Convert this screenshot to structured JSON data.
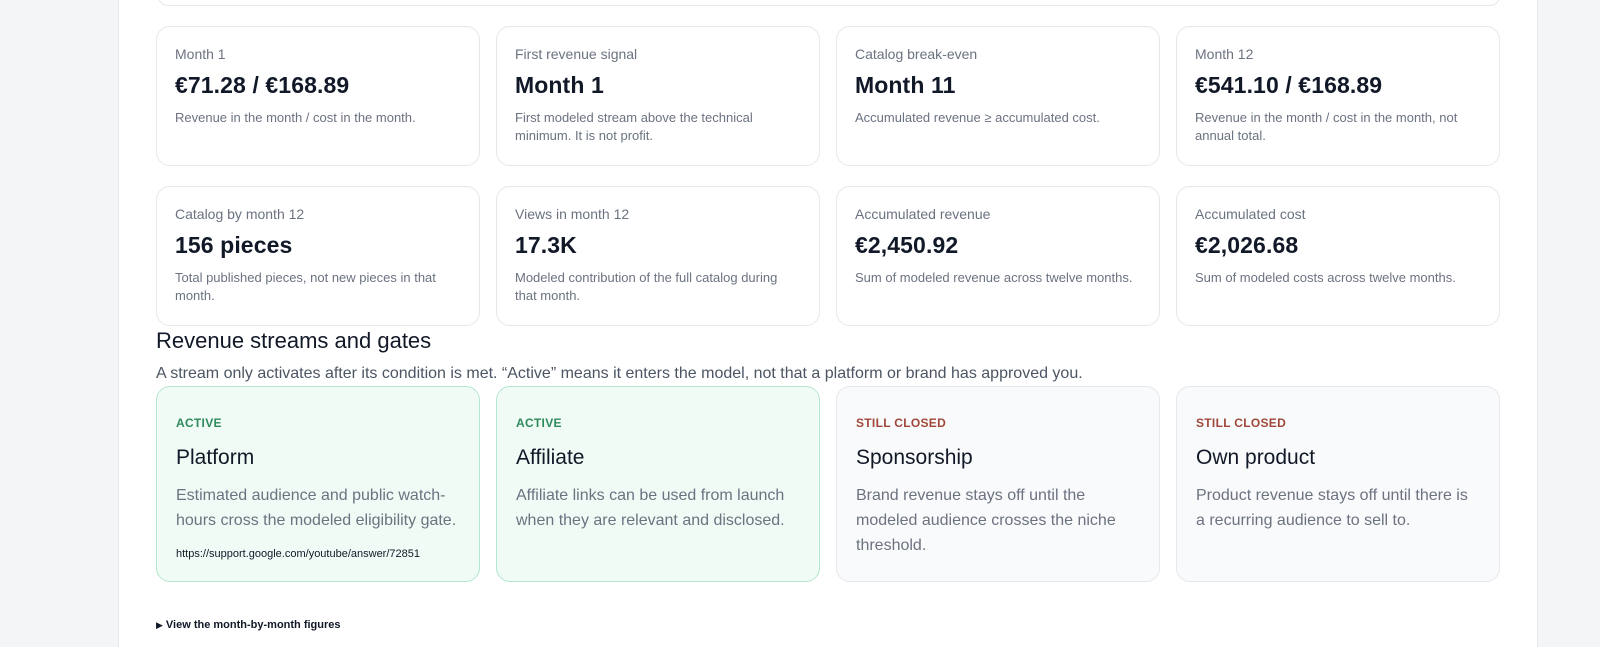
{
  "metrics_row1": [
    {
      "label": "Month 1",
      "value": "€71.28 / €168.89",
      "note": "Revenue in the month / cost in the month."
    },
    {
      "label": "First revenue signal",
      "value": "Month 1",
      "note": "First modeled stream above the technical minimum. It is not profit."
    },
    {
      "label": "Catalog break-even",
      "value": "Month 11",
      "note": "Accumulated revenue ≥ accumulated cost."
    },
    {
      "label": "Month 12",
      "value": "€541.10 / €168.89",
      "note": "Revenue in the month / cost in the month, not annual total."
    }
  ],
  "metrics_row2": [
    {
      "label": "Catalog by month 12",
      "value": "156 pieces",
      "note": "Total published pieces, not new pieces in that month."
    },
    {
      "label": "Views in month 12",
      "value": "17.3K",
      "note": "Modeled contribution of the full catalog during that month."
    },
    {
      "label": "Accumulated revenue",
      "value": "€2,450.92",
      "note": "Sum of modeled revenue across twelve months."
    },
    {
      "label": "Accumulated cost",
      "value": "€2,026.68",
      "note": "Sum of modeled costs across twelve months."
    }
  ],
  "streams_section": {
    "title": "Revenue streams and gates",
    "description": "A stream only activates after its condition is met. “Active” means it enters the model, not that a platform or brand has approved you."
  },
  "streams": [
    {
      "status": "ACTIVE",
      "name": "Platform",
      "desc": "Estimated audience and public watch-hours cross the modeled eligibility gate.",
      "link": "https://support.google.com/youtube/answer/72851"
    },
    {
      "status": "ACTIVE",
      "name": "Affiliate",
      "desc": "Affiliate links can be used from launch when they are relevant and disclosed."
    },
    {
      "status": "STILL CLOSED",
      "name": "Sponsorship",
      "desc": "Brand revenue stays off until the modeled audience crosses the niche threshold."
    },
    {
      "status": "STILL CLOSED",
      "name": "Own product",
      "desc": "Product revenue stays off until there is a recurring audience to sell to."
    }
  ],
  "details_toggle": {
    "icon": "triangle-right-icon",
    "label": "View the month-by-month figures"
  },
  "colors": {
    "active": "#2f8a5c",
    "closed": "#a0473a",
    "active_bg": "#f0fbf6"
  }
}
